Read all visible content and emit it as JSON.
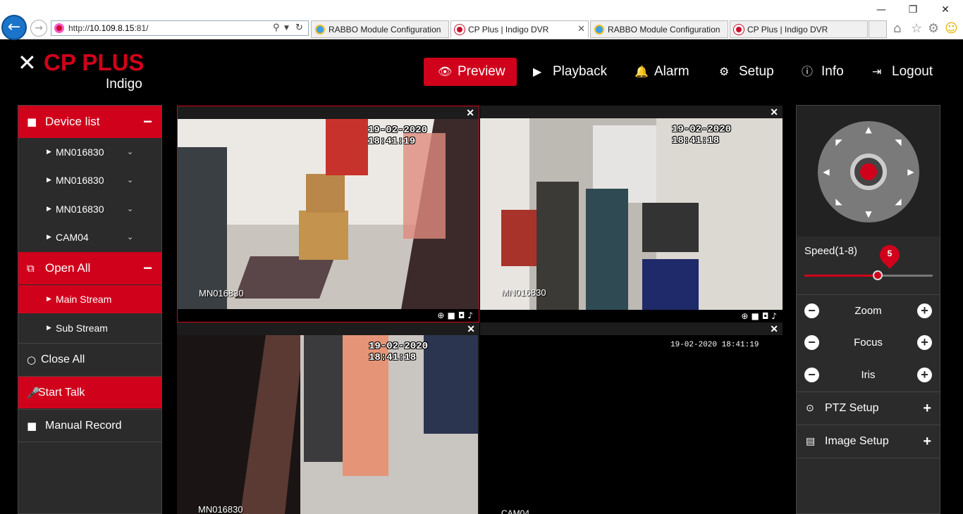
{
  "browser": {
    "url_prefix": "http://",
    "url_host": "10.109.8.15",
    "url_port": ":81/",
    "tabs": [
      {
        "label": "RABBO Module Configuration",
        "icon": "ie-icon"
      },
      {
        "label": "CP Plus | Indigo DVR",
        "icon": "cpplus-icon",
        "active": true
      },
      {
        "label": "RABBO Module Configuration",
        "icon": "ie-icon"
      },
      {
        "label": "CP Plus | Indigo DVR",
        "icon": "cpplus-icon"
      }
    ]
  },
  "logo": {
    "brand": "CP PLUS",
    "sub": "Indigo"
  },
  "nav": {
    "preview": "Preview",
    "playback": "Playback",
    "alarm": "Alarm",
    "setup": "Setup",
    "info": "Info",
    "logout": "Logout"
  },
  "sidebar": {
    "device_list": "Device list",
    "devices": [
      "MN016830",
      "MN016830",
      "MN016830",
      "CAM04"
    ],
    "open_all": "Open All",
    "main_stream": "Main Stream",
    "sub_stream": "Sub Stream",
    "close_all": "Close All",
    "start_talk": "Start Talk",
    "manual_record": "Manual Record"
  },
  "panes": [
    {
      "timestamp": "19-02-2020 18:41:19",
      "channel": "MN016830"
    },
    {
      "timestamp": "19-02-2020 18:41:18",
      "channel": "MN016830"
    },
    {
      "timestamp": "19-02-2020 18:41:18",
      "channel": "MN016830"
    },
    {
      "timestamp": "19-02-2020 18:41:19",
      "channel": "CAM04"
    }
  ],
  "ptz": {
    "speed_label": "Speed(1-8)",
    "speed_value": "5",
    "speed_fraction": 0.57,
    "zoom": "Zoom",
    "focus": "Focus",
    "iris": "Iris",
    "ptz_setup": "PTZ Setup",
    "image_setup": "Image Setup"
  },
  "colors": {
    "accent": "#d0021b",
    "panel": "#2b2b2b"
  }
}
